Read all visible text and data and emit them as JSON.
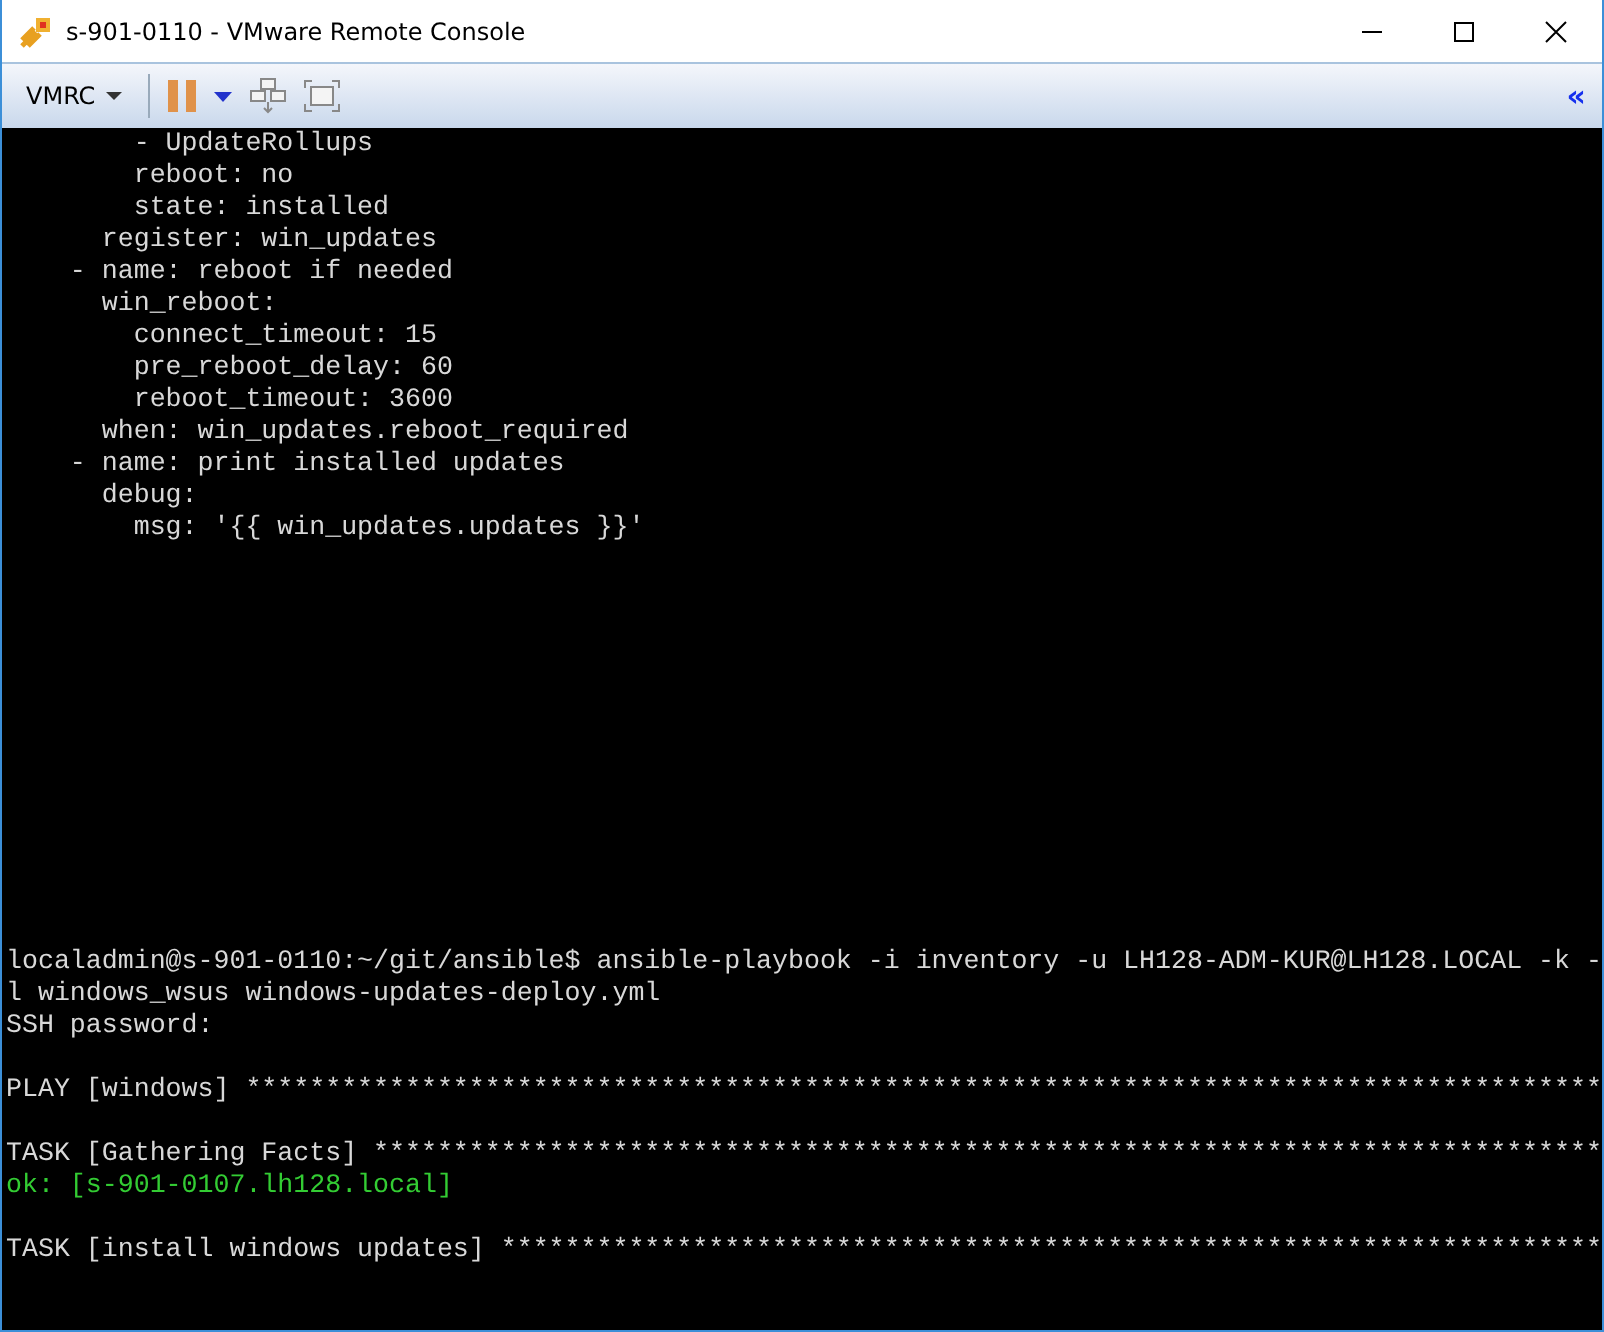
{
  "window": {
    "title": "s-901-0110 - VMware Remote Console"
  },
  "toolbar": {
    "menu_label": "VMRC",
    "collapse_glyph": "«"
  },
  "console": {
    "scrollback": [
      {
        "text": "        - UpdateRollups"
      },
      {
        "text": "        reboot: no"
      },
      {
        "text": "        state: installed"
      },
      {
        "text": "      register: win_updates"
      },
      {
        "text": "    - name: reboot if needed"
      },
      {
        "text": "      win_reboot:"
      },
      {
        "text": "        connect_timeout: 15"
      },
      {
        "text": "        pre_reboot_delay: 60"
      },
      {
        "text": "        reboot_timeout: 3600"
      },
      {
        "text": "      when: win_updates.reboot_required"
      },
      {
        "text": "    - name: print installed updates"
      },
      {
        "text": "      debug:"
      },
      {
        "text": "        msg: '{{ win_updates.updates }}'"
      }
    ],
    "session": [
      {
        "lines": [
          {
            "text": "localadmin@s-901-0110:~/git/ansible$ ansible-playbook -i inventory -u LH128-ADM-KUR@LH128.LOCAL -k -",
            "kind": "normal"
          },
          {
            "text": "l windows_wsus windows-updates-deploy.yml",
            "kind": "normal"
          },
          {
            "text": "SSH password:",
            "kind": "normal"
          }
        ]
      },
      {
        "lines": [
          {
            "text": "PLAY [windows] *************************************************************************************",
            "kind": "normal"
          }
        ]
      },
      {
        "lines": [
          {
            "text": "TASK [Gathering Facts] *****************************************************************************",
            "kind": "normal"
          },
          {
            "text": "ok: [s-901-0107.lh128.local]",
            "kind": "ok"
          }
        ]
      },
      {
        "lines": [
          {
            "text": "TASK [install windows updates] *********************************************************************",
            "kind": "normal"
          }
        ]
      }
    ]
  }
}
